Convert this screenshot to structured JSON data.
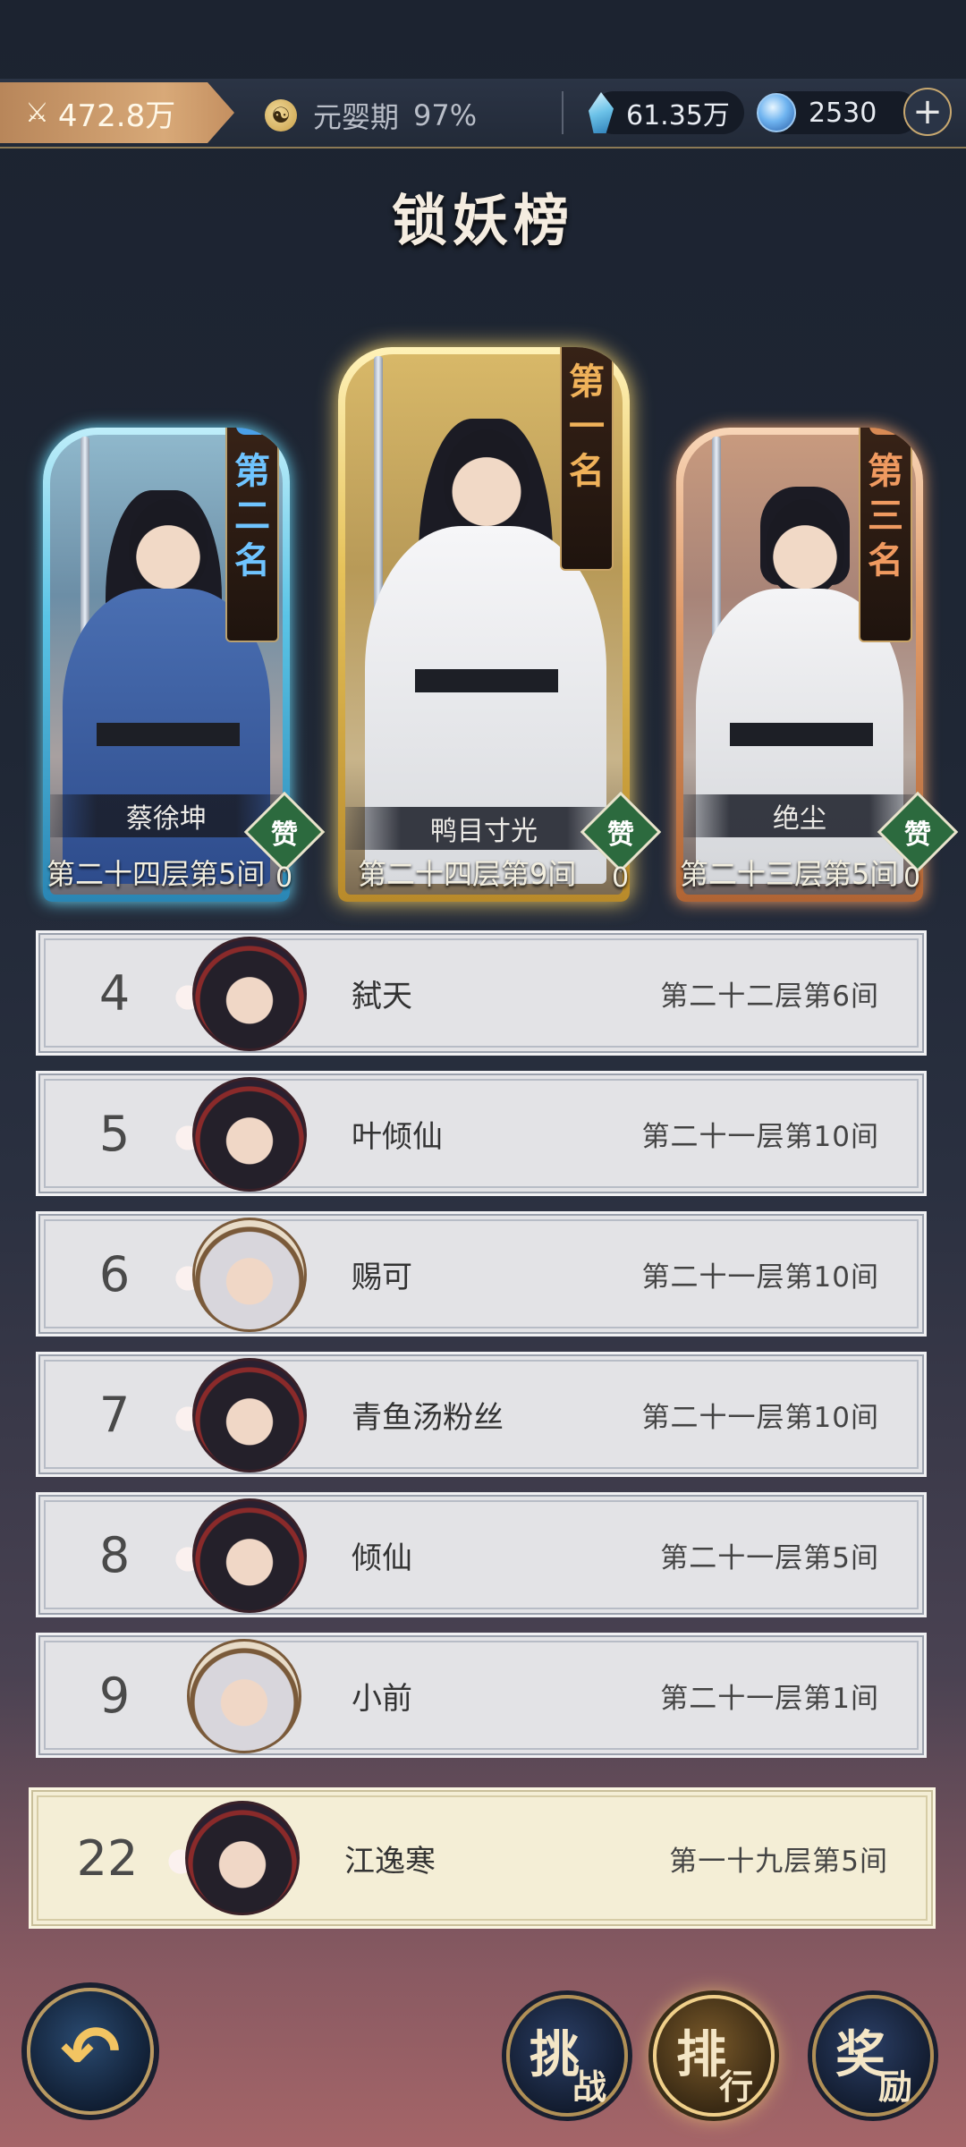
{
  "topbar": {
    "power_value": "472.8万",
    "realm_name": "元婴期",
    "realm_progress": "97%",
    "currency1": "61.35万",
    "currency2": "2530",
    "plus_symbol": "+"
  },
  "title": "锁妖榜",
  "podium": [
    {
      "rank_chars": [
        "第",
        "一",
        "名"
      ],
      "name": "鸭目寸光",
      "floor": "第二十四层第9间",
      "like_label": "赞",
      "likes": "0"
    },
    {
      "rank_chars": [
        "第",
        "二",
        "名"
      ],
      "name": "蔡徐坤",
      "floor": "第二十四层第5间",
      "like_label": "赞",
      "likes": "0"
    },
    {
      "rank_chars": [
        "第",
        "三",
        "名"
      ],
      "name": "绝尘",
      "floor": "第二十三层第5间",
      "like_label": "赞",
      "likes": "0"
    }
  ],
  "rows": [
    {
      "rank": "4",
      "name": "弑天",
      "floor": "第二十二层第6间"
    },
    {
      "rank": "5",
      "name": "叶倾仙",
      "floor": "第二十一层第10间"
    },
    {
      "rank": "6",
      "name": "赐可",
      "floor": "第二十一层第10间"
    },
    {
      "rank": "7",
      "name": "青鱼汤粉丝",
      "floor": "第二十一层第10间"
    },
    {
      "rank": "8",
      "name": "倾仙",
      "floor": "第二十一层第5间"
    },
    {
      "rank": "9",
      "name": "小前",
      "floor": "第二十一层第1间"
    }
  ],
  "my_row": {
    "rank": "22",
    "name": "江逸寒",
    "floor": "第一十九层第5间"
  },
  "buttons": {
    "back_glyph": "↶",
    "challenge": [
      "挑",
      "战"
    ],
    "ranking": [
      "排",
      "行"
    ],
    "reward": [
      "奖",
      "励"
    ]
  },
  "colors": {
    "gold_card": "#d9b24a",
    "silver_card": "#7fd6ee",
    "bronze_card": "#e0925e",
    "my_row_bg": "#f4eed6"
  }
}
